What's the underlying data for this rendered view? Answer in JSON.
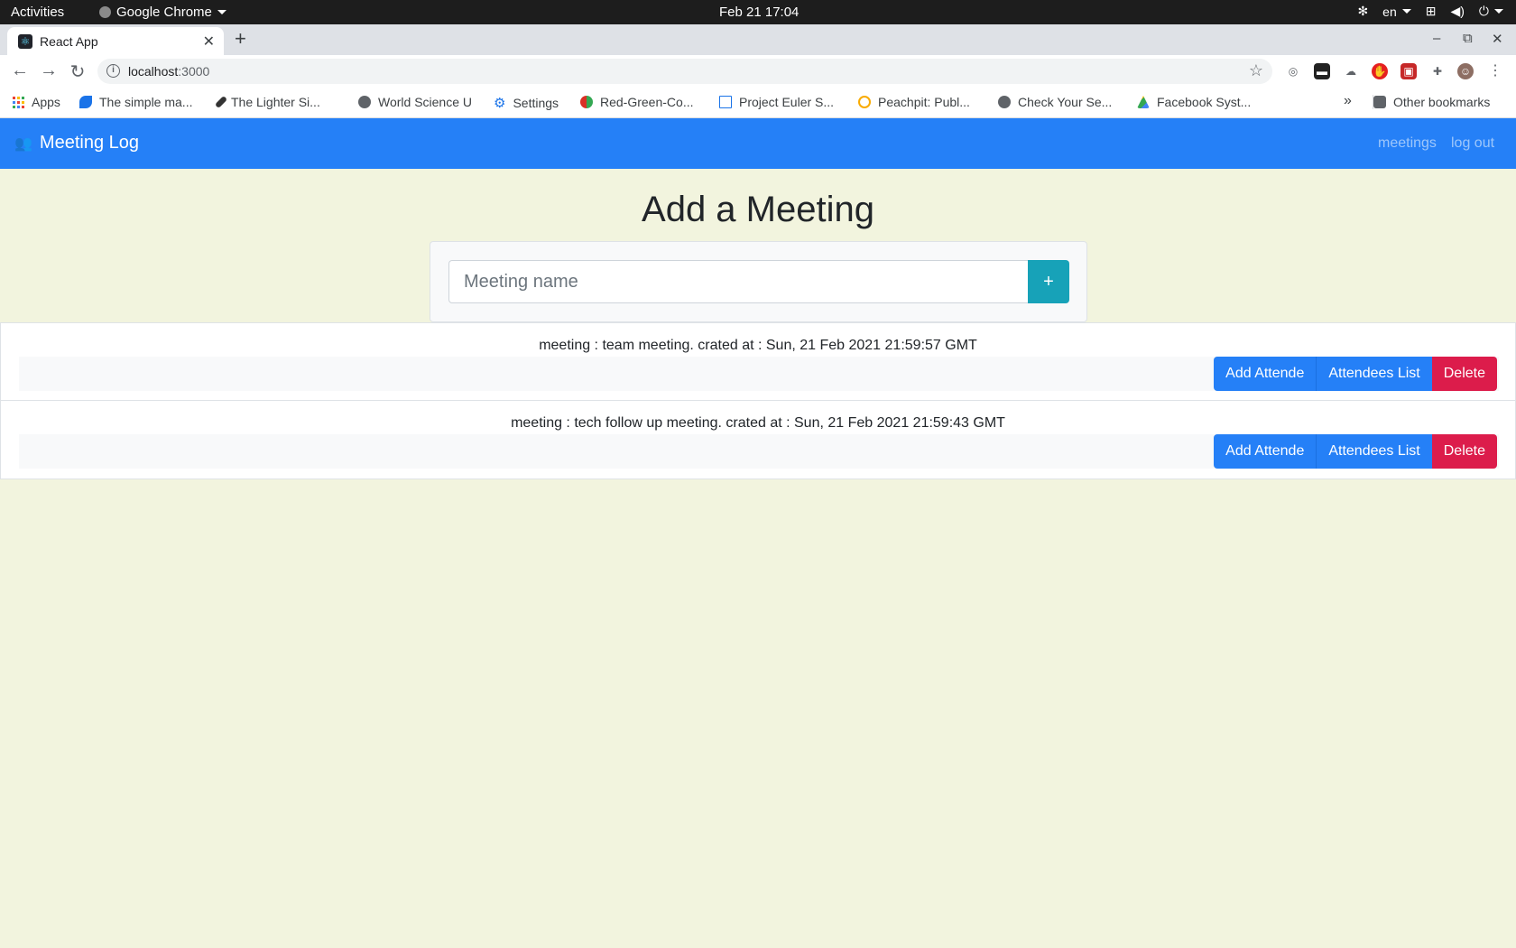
{
  "os": {
    "activities": "Activities",
    "app_name": "Google Chrome",
    "clock": "Feb 21  17:04",
    "lang": "en"
  },
  "browser": {
    "tab_title": "React App",
    "url_host": "localhost",
    "url_port": ":3000",
    "bookmarks": [
      {
        "label": "Apps",
        "icon": "apps-grid-icon",
        "color": "#4285f4"
      },
      {
        "label": "The simple ma...",
        "icon": "bird-icon",
        "color": "#1a73e8"
      },
      {
        "label": "The Lighter Si...",
        "icon": "rocket-icon",
        "color": "#333333"
      },
      {
        "label": "World Science U",
        "icon": "globe-icon",
        "color": "#5f6368"
      },
      {
        "label": "Settings",
        "icon": "gear-icon",
        "color": "#1a73e8"
      },
      {
        "label": "Red-Green-Co...",
        "icon": "circles-icon",
        "color": "#d93025"
      },
      {
        "label": "Project Euler S...",
        "icon": "table-icon",
        "color": "#1a73e8"
      },
      {
        "label": "Peachpit: Publ...",
        "icon": "clock-icon",
        "color": "#f9ab00"
      },
      {
        "label": "Check Your Se...",
        "icon": "globe-icon",
        "color": "#5f6368"
      },
      {
        "label": "Facebook Syst...",
        "icon": "drive-icon",
        "color": "#34a853"
      }
    ],
    "other_bookmarks": "Other bookmarks",
    "more_bookmarks": "»"
  },
  "app": {
    "brand": "Meeting Log",
    "nav": [
      "meetings",
      "log out"
    ],
    "page_title": "Add a Meeting",
    "input_placeholder": "Meeting name",
    "add_button": "+",
    "meetings": [
      {
        "text": "meeting : team meeting. crated at : Sun, 21 Feb 2021 21:59:57 GMT",
        "add_attendee": "Add Attende",
        "attendees_list": "Attendees List",
        "delete": "Delete"
      },
      {
        "text": "meeting : tech follow up meeting. crated at : Sun, 21 Feb 2021 21:59:43 GMT",
        "add_attendee": "Add Attende",
        "attendees_list": "Attendees List",
        "delete": "Delete"
      }
    ]
  },
  "colors": {
    "navbar": "#2580f7",
    "page_bg": "#f2f4de",
    "add_button": "#17a2b8",
    "danger": "#dc1c4b"
  }
}
